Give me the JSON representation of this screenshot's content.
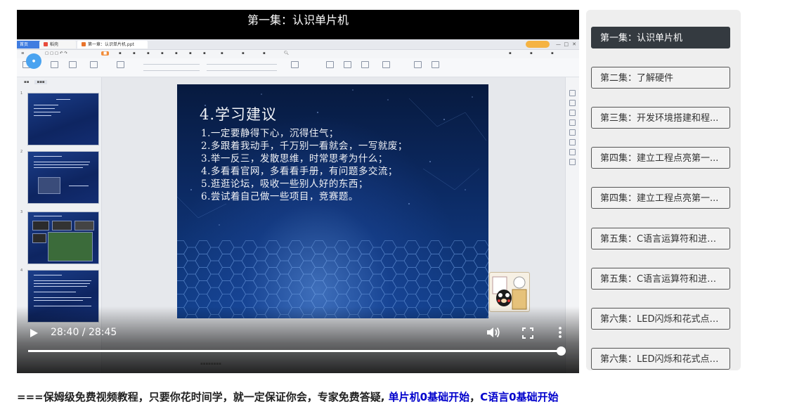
{
  "video": {
    "title": "第一集：认识单片机",
    "current_time": "28:40",
    "duration": "28:45",
    "time_display": "28:40 / 28:45",
    "progress": 0.997,
    "icons": [
      "play-icon",
      "volume-icon",
      "fullscreen-icon",
      "more-vert-icon"
    ]
  },
  "screen": {
    "app_tabs": [
      "首页",
      "稻壳",
      "第一章：认识单片机.ppt"
    ],
    "slide": {
      "title": "4.学习建议",
      "items": [
        "1.一定要静得下心，沉得住气；",
        "2.多跟着我动手，千万别一看就会，一写就废；",
        "3.举一反三，发散思维，时常思考为什么；",
        "4.多看看官网，多看看手册，有问题多交流；",
        "5.逛逛论坛，吸收一些别人好的东西；",
        "6.尝试着自己做一些项目，竞赛题。"
      ]
    },
    "thumb_numbers": [
      "1",
      "2",
      "3",
      "4"
    ]
  },
  "episodes": [
    {
      "label": "第一集：认识单片机",
      "active": true
    },
    {
      "label": "第二集：了解硬件",
      "active": false
    },
    {
      "label": "第三集：开发环境搭建和程...",
      "active": false
    },
    {
      "label": "第四集：建立工程点亮第一...",
      "active": false
    },
    {
      "label": "第四集：建立工程点亮第一...",
      "active": false
    },
    {
      "label": "第五集：C语言运算符和进制...",
      "active": false
    },
    {
      "label": "第五集：C语言运算符和进制...",
      "active": false
    },
    {
      "label": "第六集：LED闪烁和花式点灯...",
      "active": false
    },
    {
      "label": "第六集：LED闪烁和花式点灯...",
      "active": false
    }
  ],
  "promo": {
    "prefix": "===保姆级免费视频教程，只要你花时间学，就一定保证你会，专家免费答疑,",
    "link1": "单片机0基础开始",
    "separator": "，",
    "link2": "C语言0基础开始"
  },
  "colors": {
    "active_episode_bg": "#343a40",
    "link_blue": "#0000cc",
    "player_bg": "#000000",
    "slide_bg": "#0c2a63"
  }
}
